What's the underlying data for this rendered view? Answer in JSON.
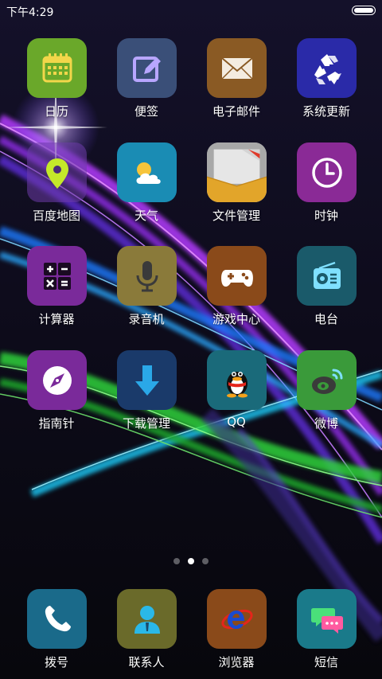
{
  "status_bar": {
    "time": "下午4:29"
  },
  "home": {
    "row1": [
      {
        "label": "日历",
        "icon": "calendar-icon",
        "color": "#6aa82a"
      },
      {
        "label": "便签",
        "icon": "note-edit-icon",
        "color": "#3a4f78"
      },
      {
        "label": "电子邮件",
        "icon": "mail-envelope-icon",
        "color": "#8a5a24"
      },
      {
        "label": "系统更新",
        "icon": "recycle-update-icon",
        "color": "#2a2aa8"
      }
    ],
    "row2": [
      {
        "label": "百度地图",
        "icon": "map-pin-icon",
        "color": "#5a2f8a"
      },
      {
        "label": "天气",
        "icon": "weather-sun-cloud-icon",
        "color": "#1a8cb4"
      },
      {
        "label": "文件管理",
        "icon": "folder-icon",
        "color": "#a8a8a8"
      },
      {
        "label": "时钟",
        "icon": "clock-icon",
        "color": "#8a2a96"
      }
    ],
    "row3": [
      {
        "label": "计算器",
        "icon": "calculator-icon",
        "color": "#7a2a9a"
      },
      {
        "label": "录音机",
        "icon": "microphone-icon",
        "color": "#8a7a3a"
      },
      {
        "label": "游戏中心",
        "icon": "gamepad-icon",
        "color": "#8a4a1a"
      },
      {
        "label": "电台",
        "icon": "radio-icon",
        "color": "#1a5a6a"
      }
    ],
    "row4": [
      {
        "label": "指南针",
        "icon": "compass-icon",
        "color": "#7a2a9a"
      },
      {
        "label": "下载管理",
        "icon": "download-arrow-icon",
        "color": "#1a3a6a"
      },
      {
        "label": "QQ",
        "icon": "qq-penguin-icon",
        "color": "#1a6a7a"
      },
      {
        "label": "微博",
        "icon": "weibo-icon",
        "color": "#3a9a3a"
      }
    ]
  },
  "page_indicator": {
    "count": 3,
    "active": 2
  },
  "dock": [
    {
      "label": "拨号",
      "icon": "phone-icon",
      "color": "#1a6a8a"
    },
    {
      "label": "联系人",
      "icon": "contact-person-icon",
      "color": "#6a6a2a"
    },
    {
      "label": "浏览器",
      "icon": "browser-ie-icon",
      "color": "#8a4a1a"
    },
    {
      "label": "短信",
      "icon": "message-bubbles-icon",
      "color": "#1a7a8a"
    }
  ]
}
